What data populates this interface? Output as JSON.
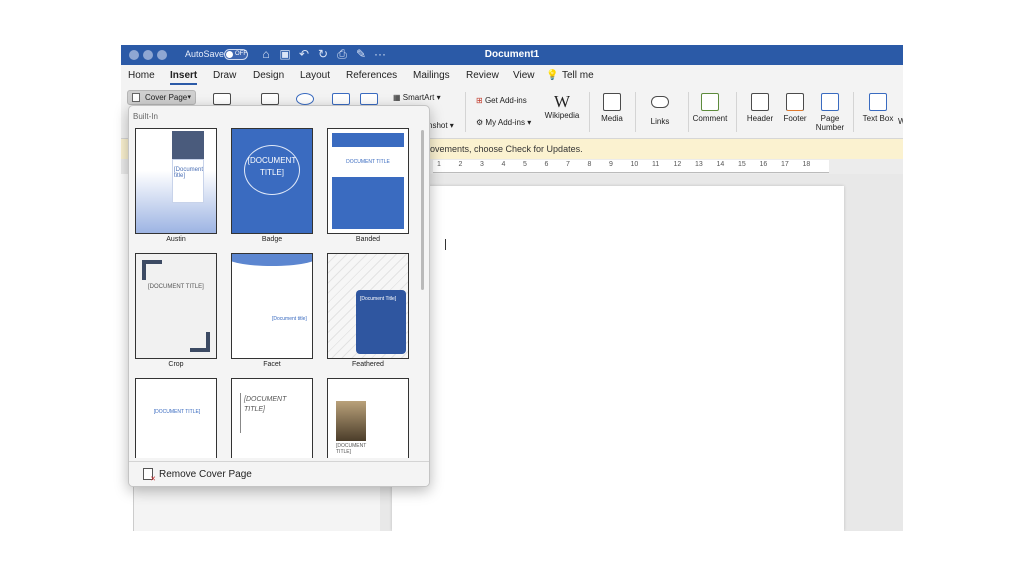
{
  "window": {
    "title": "Document1",
    "autosave_label": "AutoSave",
    "autosave_state": "OFF"
  },
  "tabs": [
    "Home",
    "Insert",
    "Draw",
    "Design",
    "Layout",
    "References",
    "Mailings",
    "Review",
    "View",
    "Tell me"
  ],
  "ribbon": {
    "cover_page": "Cover Page",
    "smartart": "SmartArt",
    "screenshot_partial": "nshot",
    "get_addins": "Get Add-ins",
    "my_addins": "My Add-ins",
    "wikipedia": "Wikipedia",
    "media": "Media",
    "links": "Links",
    "comment": "Comment",
    "header": "Header",
    "footer": "Footer",
    "page_number": "Page Number",
    "text_box": "Text Box",
    "truncated": "W"
  },
  "message_bar": "rovements, choose Check for Updates.",
  "ruler_numbers": [
    "1",
    "2",
    "3",
    "4",
    "5",
    "6",
    "7",
    "8",
    "9",
    "10",
    "11",
    "12",
    "13",
    "14",
    "15",
    "16",
    "17",
    "18"
  ],
  "gallery": {
    "section": "Built-In",
    "items": [
      {
        "label": "Austin",
        "text": "[Document title]"
      },
      {
        "label": "Badge",
        "text": "[DOCUMENT TITLE]"
      },
      {
        "label": "Banded",
        "text": "DOCUMENT TITLE"
      },
      {
        "label": "Crop",
        "text": "[DOCUMENT TITLE]"
      },
      {
        "label": "Facet",
        "text": "[Document title]"
      },
      {
        "label": "Feathered",
        "text": "[Document Title]"
      },
      {
        "label": "",
        "text": "[DOCUMENT TITLE]"
      },
      {
        "label": "",
        "text": "[DOCUMENT TITLE]"
      },
      {
        "label": "",
        "text": "[DOCUMENT TITLE]"
      }
    ],
    "remove": "Remove Cover Page"
  },
  "colors": {
    "titlebar": "#2b5aa7",
    "accent": "#3a6bc0",
    "message_bar": "#fbf2d0"
  }
}
